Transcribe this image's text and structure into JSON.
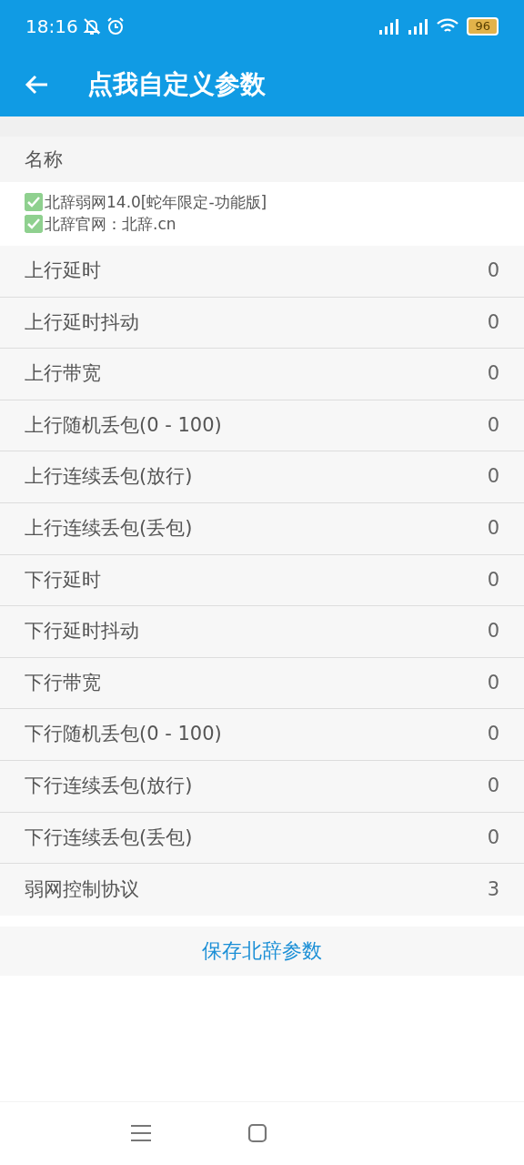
{
  "status_bar": {
    "time": "18:16",
    "battery": "96"
  },
  "toolbar": {
    "title": "点我自定义参数"
  },
  "section": {
    "title": "名称"
  },
  "notes": [
    "北辞弱网14.0[蛇年限定-功能版]",
    "北辞官网：北辞.cn"
  ],
  "params": [
    {
      "label": "上行延时",
      "value": "0"
    },
    {
      "label": "上行延时抖动",
      "value": "0"
    },
    {
      "label": "上行带宽",
      "value": "0"
    },
    {
      "label": "上行随机丢包(0 - 100)",
      "value": "0"
    },
    {
      "label": "上行连续丢包(放行)",
      "value": "0"
    },
    {
      "label": "上行连续丢包(丢包)",
      "value": "0"
    },
    {
      "label": "下行延时",
      "value": "0"
    },
    {
      "label": "下行延时抖动",
      "value": "0"
    },
    {
      "label": "下行带宽",
      "value": "0"
    },
    {
      "label": "下行随机丢包(0 - 100)",
      "value": "0"
    },
    {
      "label": "下行连续丢包(放行)",
      "value": "0"
    },
    {
      "label": "下行连续丢包(丢包)",
      "value": "0"
    },
    {
      "label": "弱网控制协议",
      "value": "3"
    }
  ],
  "save_button": "保存北辞参数"
}
